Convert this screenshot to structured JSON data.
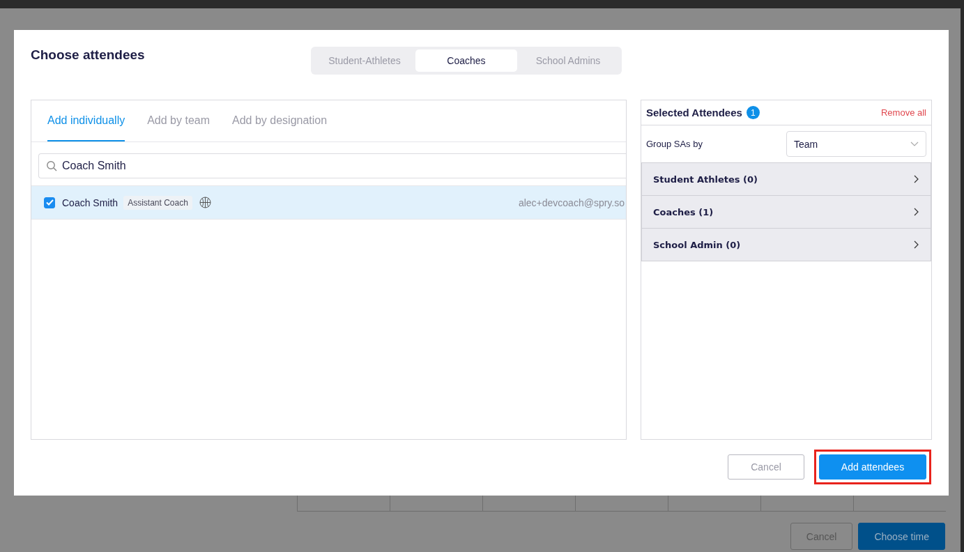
{
  "background": {
    "buttons": [
      {
        "label": "Cancel",
        "kind": "secondary"
      },
      {
        "label": "Choose time",
        "kind": "primary"
      }
    ]
  },
  "dialog": {
    "title": "Choose attendees",
    "role_tabs": [
      {
        "label": "Student-Athletes",
        "selected": false
      },
      {
        "label": "Coaches",
        "selected": true
      },
      {
        "label": "School Admins",
        "selected": false
      }
    ],
    "add_tabs": [
      {
        "label": "Add individually",
        "selected": true
      },
      {
        "label": "Add by team",
        "selected": false
      },
      {
        "label": "Add by designation",
        "selected": false
      }
    ],
    "search": {
      "value": "Coach Smith"
    },
    "results": [
      {
        "name": "Coach Smith",
        "role": "Assistant Coach",
        "email": "alec+devcoach@spry.so",
        "checked": true,
        "selected": true
      }
    ],
    "selected_panel": {
      "title": "Selected Attendees",
      "count": "1",
      "remove_all": "Remove all",
      "group_label": "Group SAs by",
      "group_value": "Team",
      "groups": [
        {
          "label": "Student Athletes (0)",
          "expanded": false
        },
        {
          "label": "Coaches (1)",
          "expanded": false
        },
        {
          "label": "School Admin (0)",
          "expanded": false
        }
      ]
    },
    "buttons": [
      {
        "label": "Cancel",
        "kind": "secondary",
        "highlighted": false
      },
      {
        "label": "Add attendees",
        "kind": "primary",
        "highlighted": true
      }
    ]
  }
}
